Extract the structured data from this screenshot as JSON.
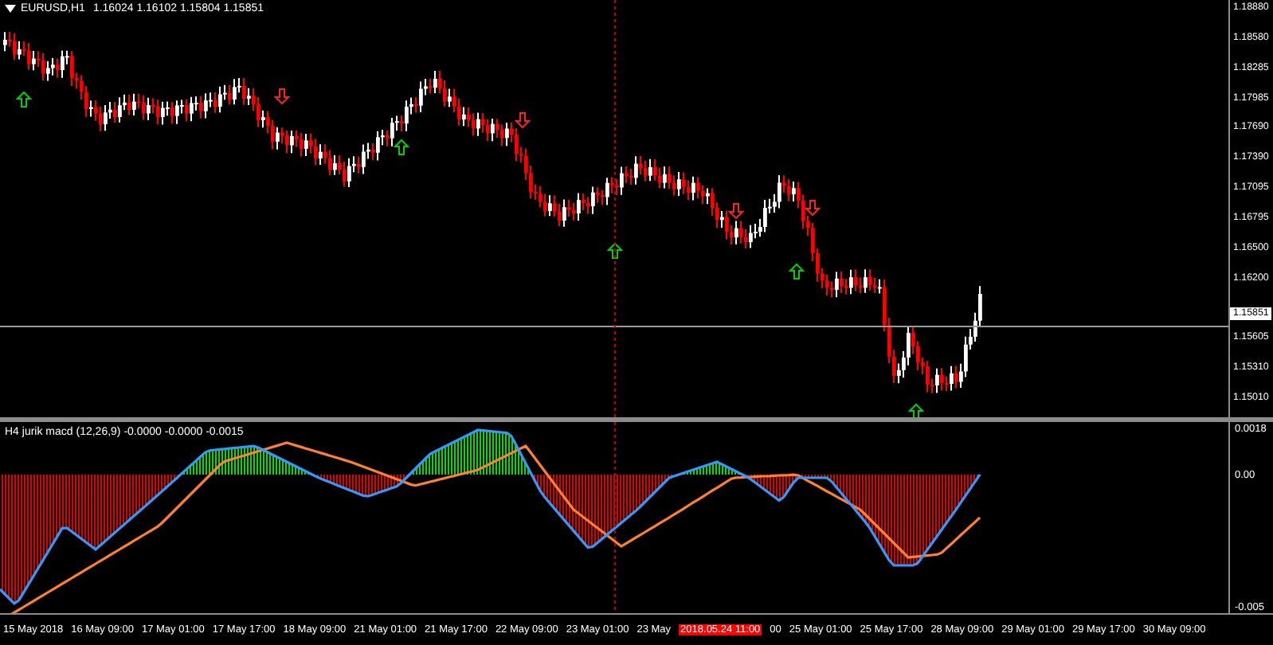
{
  "chart": {
    "symbol": "EURUSD,H1",
    "ohlc": "1.16024 1.16102 1.15804 1.15851"
  },
  "price_axis": [
    "1.18880",
    "1.18580",
    "1.18285",
    "1.17985",
    "1.17690",
    "1.17390",
    "1.17095",
    "1.16795",
    "1.16500",
    "1.16200",
    "1.15605",
    "1.15310",
    "1.15010"
  ],
  "current_price": "1.15851",
  "indicator": {
    "label": "H4 jurik macd (12,26,9) -0.0000 -0.0000 -0.0015",
    "axis": [
      "0.0018",
      "0.00",
      "-0.005"
    ]
  },
  "time_axis": [
    {
      "text": "15 May 2018",
      "kind": "tick"
    },
    {
      "text": "16 May 09:00",
      "kind": "tick"
    },
    {
      "text": "17 May 01:00",
      "kind": "tick"
    },
    {
      "text": "17 May 17:00",
      "kind": "tick"
    },
    {
      "text": "18 May 09:00",
      "kind": "tick"
    },
    {
      "text": "21 May 01:00",
      "kind": "tick"
    },
    {
      "text": "21 May 17:00",
      "kind": "tick"
    },
    {
      "text": "22 May 09:00",
      "kind": "tick"
    },
    {
      "text": "23 May 01:00",
      "kind": "tick"
    },
    {
      "text": "23 May",
      "kind": "tick"
    },
    {
      "text": "2018.05.24 11:00",
      "kind": "crosshair"
    },
    {
      "text": "00",
      "kind": "tick"
    },
    {
      "text": "25 May 01:00",
      "kind": "tick"
    },
    {
      "text": "25 May 17:00",
      "kind": "tick"
    },
    {
      "text": "28 May 09:00",
      "kind": "tick"
    },
    {
      "text": "29 May 01:00",
      "kind": "tick"
    },
    {
      "text": "29 May 17:00",
      "kind": "tick"
    },
    {
      "text": "30 May 09:00",
      "kind": "tick"
    }
  ]
}
